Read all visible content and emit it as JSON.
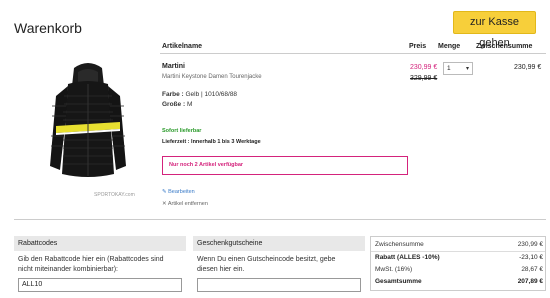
{
  "header": {
    "title": "Warenkorb",
    "checkout_label": "zur Kasse gehen"
  },
  "columns": {
    "name": "Artikelname",
    "price": "Preis",
    "qty": "Menge",
    "subtotal": "Zwischensumme"
  },
  "item": {
    "name": "Martini",
    "description": "Martini Keystone Damen Tourenjacke",
    "color_label": "Farbe :",
    "color_value": "Gelb | 1010/68/88",
    "size_label": "Große :",
    "size_value": "M",
    "stock": "Sofort lieferbar",
    "delivery_label": "Lieferzeit :",
    "delivery_value": "Innerhalb 1 bis 3 Werktage",
    "warning": "Nur noch 2 Artikel verfügbar",
    "edit_label": "Bearbeiten",
    "remove_label": "Artikel entfernen",
    "price_sale": "230,99 €",
    "price_old": "329,99 €",
    "quantity": "1",
    "subtotal": "230,99 €",
    "image_caption": "SPORTOKAY.com"
  },
  "coupon": {
    "title": "Rabattcodes",
    "text_line1": "Gib den Rabattcode hier ein (Rabattcodes sind",
    "text_line2": "nicht miteinander kombinierbar):",
    "value": "ALL10"
  },
  "giftcard": {
    "title": "Geschenkgutscheine",
    "text_line1": "Wenn Du einen Gutscheincode besitzt, gebe",
    "text_line2": "diesen hier ein.",
    "value": ""
  },
  "summary": {
    "subtotal_label": "Zwischensumme",
    "subtotal_value": "230,99 €",
    "discount_label": "Rabatt (ALLES -10%)",
    "discount_value": "-23,10 €",
    "tax_label": "MwSt. (16%)",
    "tax_value": "28,67 €",
    "total_label": "Gesamtsumme",
    "total_value": "207,89 €"
  },
  "colors": {
    "accent": "#f7cf3a",
    "sale": "#d4237c",
    "stock": "#2a9a2a",
    "link": "#3a7bc8"
  }
}
